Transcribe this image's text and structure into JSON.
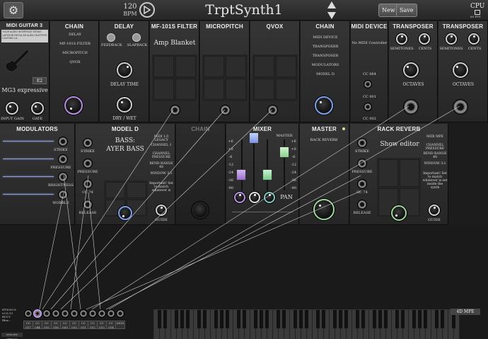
{
  "topbar": {
    "bpm_value": "120",
    "bpm_label": "BPM",
    "title": "TrptSynth1",
    "new_label": "New",
    "save_label": "Save",
    "cpu_label": "CPU",
    "fps_label": "60 FPS"
  },
  "panels_top": {
    "midi_guitar": {
      "title": "MIDI GUITAR 3",
      "warning": "YOUR AUDIO INTERFACE SENDS LARGE/IR REGULAR AUDIO BUFFERS CAUSING LA...",
      "note": "E2",
      "preset": "MG3 expressive",
      "knob1": "INPUT GAIN",
      "knob2": "GATE"
    },
    "chain1": {
      "title": "CHAIN",
      "items": [
        "DELAY",
        "MF-101S FILTER",
        "MICROPITCH",
        "QVOX"
      ]
    },
    "delay": {
      "title": "DELAY",
      "feedback": "FEEDBACK",
      "slapback": "SLAPBACK",
      "time": "DELAY TIME",
      "drywet": "DRY / WET"
    },
    "filter": {
      "title": "MF-101S FILTER",
      "preset": "Amp Blanket"
    },
    "micropitch": {
      "title": "MICROPITCH"
    },
    "qvox": {
      "title": "QVOX"
    },
    "chain2": {
      "title": "CHAIN",
      "items": [
        "MIDI DEVICE",
        "TRANSPOSER",
        "TRANSPOSER",
        "MODULATORS",
        "MODEL D"
      ]
    },
    "midi_device": {
      "title": "MIDI DEVICE",
      "name": "No MIDI Controller",
      "cc1": "CC 064",
      "cc2": "CC 001",
      "cc3": "CC 002"
    },
    "transposer1": {
      "title": "TRANSPOSER",
      "semitones": "SEMITONES",
      "cents": "CENTS",
      "octaves": "OCTAVES"
    },
    "transposer2": {
      "title": "TRANSPOSER",
      "semitones": "SEMITONES",
      "cents": "CENTS",
      "octaves": "OCTAVES"
    }
  },
  "panels_bottom": {
    "modulators": {
      "title": "MODULATORS",
      "labels": [
        "STRIKE",
        "PRESSURE",
        "BRIGHTNESS",
        "WOBBLE"
      ]
    },
    "model_d": {
      "title": "MODEL D",
      "preset_line1": "BASS:",
      "preset_line2": "AYER BASS",
      "left_labels": [
        "STRIKE",
        "PRESSURE",
        "CC 74",
        "RELEASE"
      ],
      "right_labels": [
        "MIDI 1.0 LEGACY",
        "CHANNEL 1",
        "CHANNEL PRESSURE",
        "BEND RANGE 48",
        "WINDOW 3:1",
        "Important! Set to match whatever is"
      ],
      "guide": "GUIDE"
    },
    "chain3": {
      "title": "CHAIN"
    },
    "mixer": {
      "title": "MIXER",
      "master": "MASTER",
      "scale": [
        "+6",
        "+0",
        "-6",
        "-12",
        "-24",
        "-36",
        "-90"
      ],
      "pan": "PAN"
    },
    "master": {
      "title": "MASTER",
      "items": [
        "RACK REVERB"
      ]
    },
    "rack_reverb": {
      "title": "RACK REVERB",
      "preset": "Show editor",
      "left_labels": [
        "STRIKE",
        "PRESSURE",
        "CC 74",
        "RELEASE"
      ],
      "right_labels": [
        "MIDI MPE",
        "CHANNEL PRESSURE",
        "BEND RANGE 48",
        "WINDOW 3:1",
        "Important! Set to match whatever is set inside the synth"
      ],
      "guide": "GUIDE"
    }
  },
  "footer": {
    "device": "BT5005-6 v3.8.13 BUCY Blue...",
    "reset": "RESTORE DEFAULT",
    "cc_labels": [
      "CC 017",
      "CC 044",
      "CC 015",
      "CC 016",
      "CC 009",
      "CC 010",
      "CC 011",
      "CC 012",
      "CC 013",
      "CC 014",
      "MIDI"
    ],
    "mpe_label": "4D MPE"
  }
}
